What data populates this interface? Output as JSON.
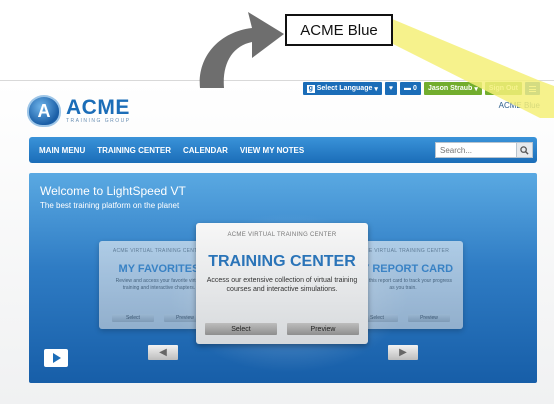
{
  "annotation": {
    "callout_text": "ACME Blue",
    "highlight_color": "#f5f078",
    "arrow_color": "#6e6e6e"
  },
  "topbar": {
    "language_label": "Select Language",
    "language_icon": "google-icon",
    "favorites_icon": "heart-icon",
    "messages_icon": "message-icon",
    "messages_count": "0",
    "user_label": "Jason Straub",
    "signout_label": "Sign Out",
    "menu_icon": "hamburger-icon"
  },
  "theme_label": "ACME Blue",
  "logo": {
    "letter": "A",
    "name": "ACME",
    "tagline": "TRAINING GROUP"
  },
  "nav": {
    "items": [
      "MAIN MENU",
      "TRAINING CENTER",
      "CALENDAR",
      "VIEW MY NOTES"
    ],
    "search_placeholder": "Search..."
  },
  "hero": {
    "title": "Welcome to LightSpeed VT",
    "subtitle": "The best training platform on the planet"
  },
  "cards": {
    "left": {
      "header": "ACME VIRTUAL TRAINING CENTER",
      "title": "MY FAVORITES",
      "desc": "Review and access your favorite virtual training and interactive chapters.",
      "select": "Select",
      "preview": "Preview"
    },
    "main": {
      "header": "ACME VIRTUAL TRAINING CENTER",
      "title": "TRAINING CENTER",
      "desc": "Access our extensive collection of virtual training courses and interactive simulations.",
      "select": "Select",
      "preview": "Preview"
    },
    "right": {
      "header": "ACME VIRTUAL TRAINING CENTER",
      "title": "MY REPORT CARD",
      "desc": "Utilize this report card to track your progress as you train.",
      "select": "Select",
      "preview": "Preview"
    }
  },
  "colors": {
    "brand_blue": "#1b6db8",
    "topbar_green": "#72ad2e"
  }
}
